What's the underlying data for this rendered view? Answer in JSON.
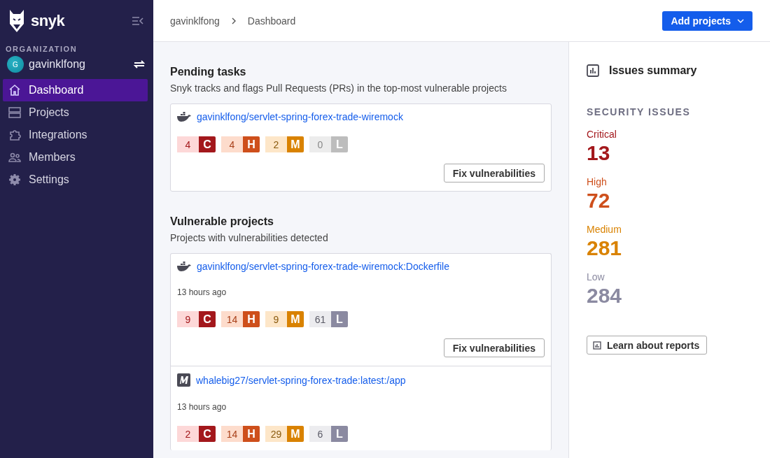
{
  "sidebar": {
    "brand": "snyk",
    "org_label": "ORGANIZATION",
    "org": {
      "initial": "G",
      "name": "gavinklfong"
    },
    "items": [
      {
        "label": "Dashboard",
        "kind": "home",
        "selected": true
      },
      {
        "label": "Projects",
        "kind": "projects",
        "selected": false
      },
      {
        "label": "Integrations",
        "kind": "puzzle",
        "selected": false
      },
      {
        "label": "Members",
        "kind": "members",
        "selected": false
      },
      {
        "label": "Settings",
        "kind": "gear",
        "selected": false
      }
    ]
  },
  "breadcrumb": [
    "gavinklfong",
    "Dashboard"
  ],
  "add_button": "Add projects",
  "pending": {
    "title": "Pending tasks",
    "subtitle": "Snyk tracks and flags Pull Requests (PRs) in the top-most vulnerable projects",
    "projects": [
      {
        "kind": "docker",
        "name": "gavinklfong/servlet-spring-forex-trade-wiremock",
        "badges": [
          {
            "kind": "critical",
            "count": "4",
            "letter": "C",
            "muted": false
          },
          {
            "kind": "high",
            "count": "4",
            "letter": "H",
            "muted": false
          },
          {
            "kind": "medium",
            "count": "2",
            "letter": "M",
            "muted": false
          },
          {
            "kind": "low",
            "count": "0",
            "letter": "L",
            "muted": true
          }
        ],
        "button": "Fix vulnerabilities"
      }
    ]
  },
  "vulnerable": {
    "title": "Vulnerable projects",
    "subtitle": "Projects with vulnerabilities detected",
    "projects": [
      {
        "kind": "docker",
        "name": "gavinklfong/servlet-spring-forex-trade-wiremock:Dockerfile",
        "time": "13 hours ago",
        "badges": [
          {
            "kind": "critical",
            "count": "9",
            "letter": "C",
            "muted": false
          },
          {
            "kind": "high",
            "count": "14",
            "letter": "H",
            "muted": false
          },
          {
            "kind": "medium",
            "count": "9",
            "letter": "M",
            "muted": false
          },
          {
            "kind": "low",
            "count": "61",
            "letter": "L",
            "muted": false
          }
        ],
        "button": "Fix vulnerabilities"
      },
      {
        "kind": "m",
        "name": "whalebig27/servlet-spring-forex-trade:latest:/app",
        "time": "13 hours ago",
        "badges": [
          {
            "kind": "critical",
            "count": "2",
            "letter": "C",
            "muted": false
          },
          {
            "kind": "high",
            "count": "14",
            "letter": "H",
            "muted": false
          },
          {
            "kind": "medium",
            "count": "29",
            "letter": "M",
            "muted": false
          },
          {
            "kind": "low",
            "count": "6",
            "letter": "L",
            "muted": false
          }
        ]
      }
    ]
  },
  "summary": {
    "title": "Issues summary",
    "section": "SECURITY ISSUES",
    "items": [
      {
        "kind": "critical",
        "label": "Critical",
        "value": "13"
      },
      {
        "kind": "high",
        "label": "High",
        "value": "72"
      },
      {
        "kind": "medium",
        "label": "Medium",
        "value": "281"
      },
      {
        "kind": "low",
        "label": "Low",
        "value": "284"
      }
    ],
    "button": "Learn about reports"
  }
}
